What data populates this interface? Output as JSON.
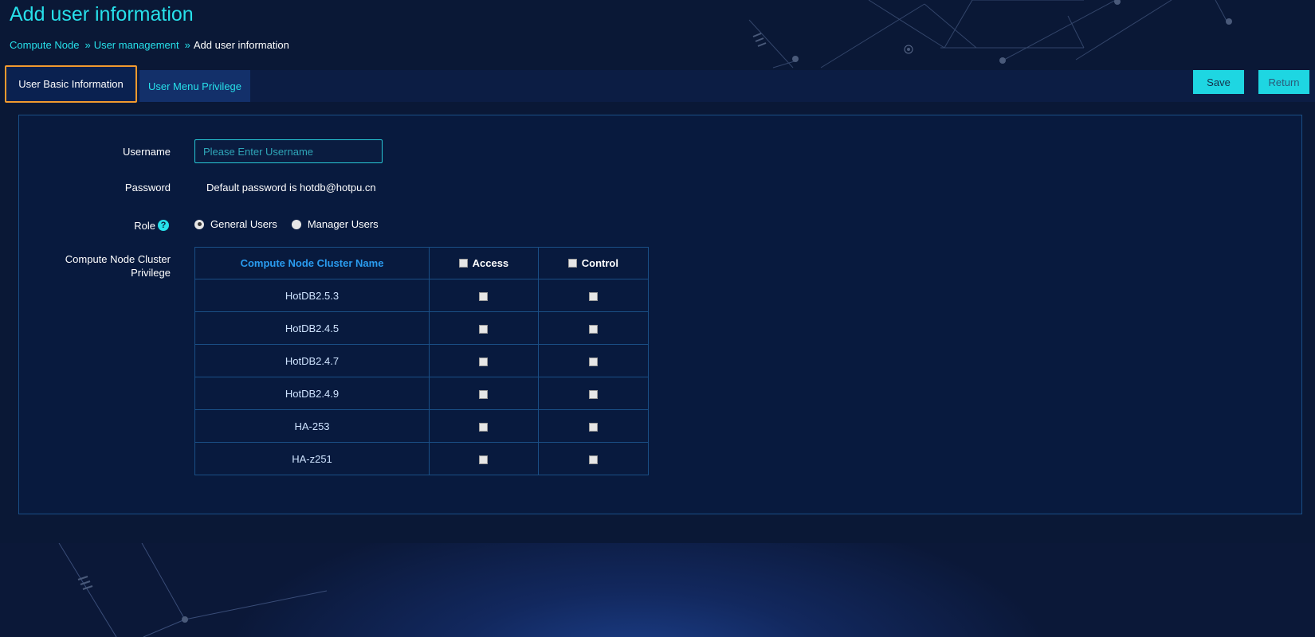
{
  "page": {
    "title": "Add user information"
  },
  "breadcrumb": {
    "items": [
      "Compute Node",
      "User management"
    ],
    "separator": "»",
    "current": "Add user information"
  },
  "tabs": [
    {
      "label": "User Basic Information",
      "active": true
    },
    {
      "label": "User Menu Privilege",
      "active": false
    }
  ],
  "actions": {
    "save_label": "Save",
    "return_label": "Return"
  },
  "form": {
    "username": {
      "label": "Username",
      "value": "",
      "placeholder": "Please Enter Username"
    },
    "password": {
      "label": "Password",
      "text": "Default password is hotdb@hotpu.cn"
    },
    "role": {
      "label": "Role",
      "help_icon": "question-circle-icon",
      "help_glyph": "?",
      "options": [
        {
          "label": "General Users",
          "checked": true
        },
        {
          "label": "Manager Users",
          "checked": false
        }
      ]
    },
    "cluster_privilege": {
      "label": "Compute Node Cluster Privilege",
      "columns": [
        "Compute Node Cluster Name",
        "Access",
        "Control"
      ],
      "rows": [
        {
          "name": "HotDB2.5.3",
          "access": false,
          "control": false
        },
        {
          "name": "HotDB2.4.5",
          "access": false,
          "control": false
        },
        {
          "name": "HotDB2.4.7",
          "access": false,
          "control": false
        },
        {
          "name": "HotDB2.4.9",
          "access": false,
          "control": false
        },
        {
          "name": "HA-253",
          "access": false,
          "control": false
        },
        {
          "name": "HA-z251",
          "access": false,
          "control": false
        }
      ]
    }
  },
  "colors": {
    "accent": "#27e0ea",
    "background": "#0a1836",
    "active_tab_border": "#f29a2e",
    "table_header_link": "#2a9cf0"
  }
}
